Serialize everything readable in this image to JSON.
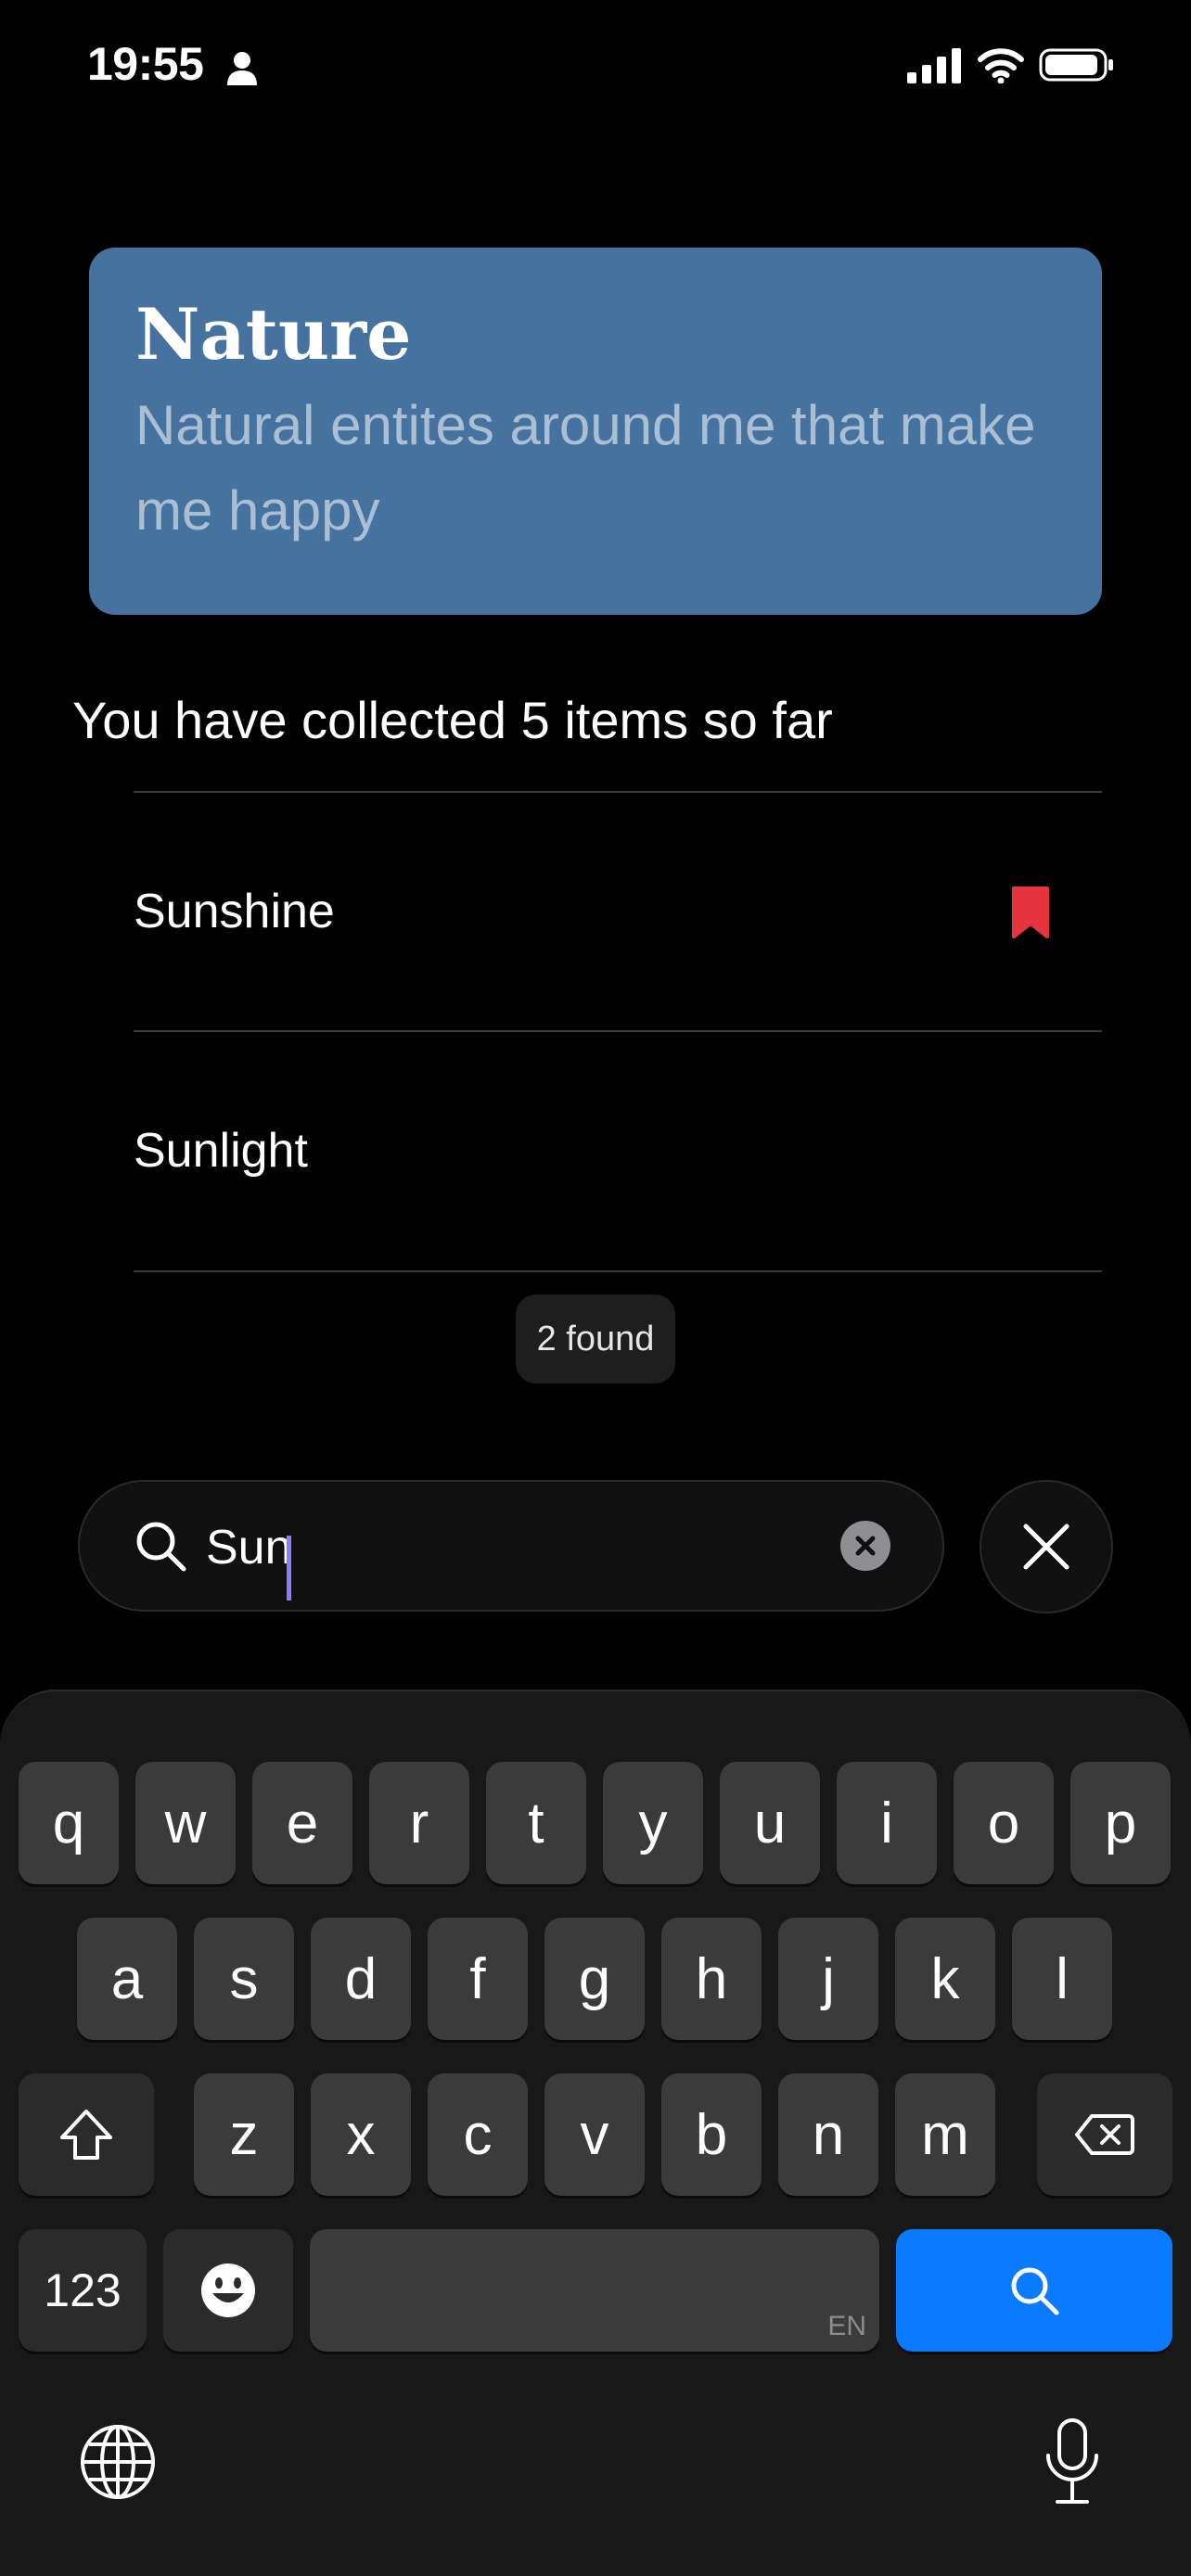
{
  "status": {
    "time": "19:55"
  },
  "collection": {
    "title": "Nature",
    "subtitle": "Natural entites around me that make me happy",
    "accent_color": "#4672a0"
  },
  "collected_text": "You have collected 5 items so far",
  "results": [
    {
      "label": "Sunshine",
      "bookmarked": true,
      "bookmark_color": "#e5343d"
    },
    {
      "label": "Sunlight",
      "bookmarked": false
    }
  ],
  "found_badge": "2 found",
  "search": {
    "value": "Sun"
  },
  "keyboard": {
    "row1": [
      "q",
      "w",
      "e",
      "r",
      "t",
      "y",
      "u",
      "i",
      "o",
      "p"
    ],
    "row2": [
      "a",
      "s",
      "d",
      "f",
      "g",
      "h",
      "j",
      "k",
      "l"
    ],
    "row3": [
      "z",
      "x",
      "c",
      "v",
      "b",
      "n",
      "m"
    ],
    "numbers_key": "123",
    "space_language": "EN",
    "action_color": "#0a7aff"
  }
}
